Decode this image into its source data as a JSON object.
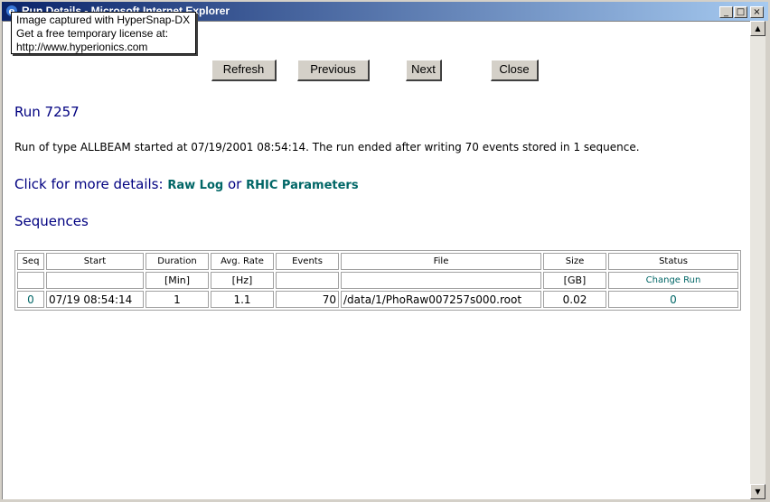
{
  "window": {
    "title": "Run Details - Microsoft Internet Explorer",
    "minimize": "_",
    "maximize": "□",
    "close": "×"
  },
  "tooltip": {
    "line1": "Image captured with HyperSnap-DX",
    "line2": "Get a free temporary license at:",
    "line3": "http://www.hyperionics.com"
  },
  "nav": {
    "refresh": "Refresh",
    "previous": "Previous",
    "next": "Next",
    "close": "Close"
  },
  "run": {
    "heading": "Run 7257",
    "description": "Run of type ALLBEAM started at 07/19/2001 08:54:14. The run ended after writing 70 events stored in 1 sequence.",
    "details_prefix": "Click for more details:",
    "raw_log": "Raw Log",
    "or": "or",
    "rhic": "RHIC Parameters"
  },
  "sequences": {
    "heading": "Sequences",
    "columns": [
      "Seq",
      "Start",
      "Duration",
      "Avg. Rate",
      "Events",
      "File",
      "Size",
      "Status"
    ],
    "units": [
      "",
      "",
      "[Min]",
      "[Hz]",
      "",
      "",
      "[GB]",
      "Change Run"
    ],
    "rows": [
      [
        "0",
        "07/19 08:54:14",
        "1",
        "1.1",
        "70",
        "/data/1/PhoRaw007257s000.root",
        "0.02",
        "0"
      ]
    ]
  },
  "scrollbar": {
    "up": "▲",
    "down": "▼"
  }
}
